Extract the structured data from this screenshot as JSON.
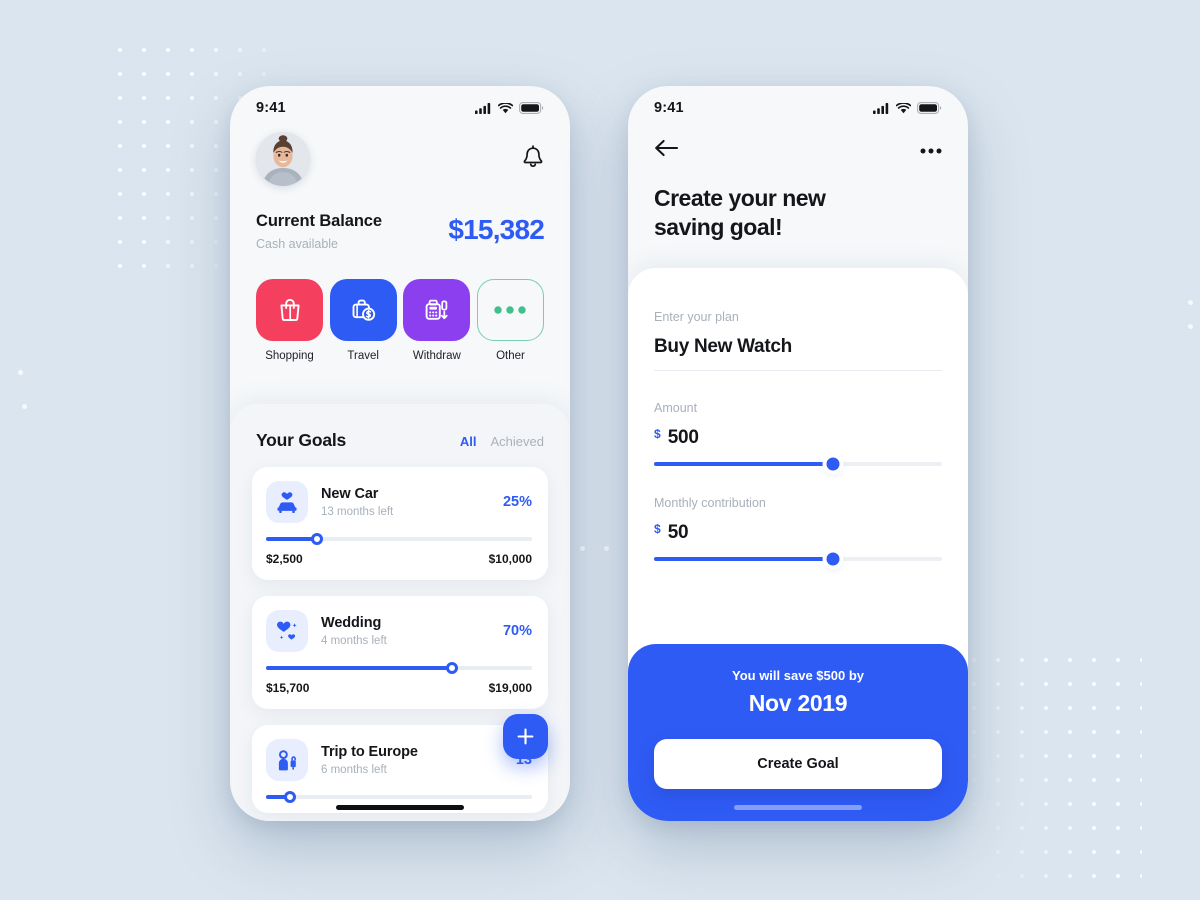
{
  "background": {
    "color": "#dbe5ef",
    "dot_color": "#ffffff"
  },
  "theme": {
    "accent_blue": "#2f5bf5",
    "shopping_pink": "#f43f5e",
    "travel_blue": "#2f5bf5",
    "withdraw_purple": "#8b3fef",
    "other_outline_green": "#77cfae",
    "text_dark": "#14161a",
    "text_muted": "#a8b0ba"
  },
  "home_screen": {
    "status_bar": {
      "time": "9:41",
      "icons": [
        "cellular-signal-icon",
        "wifi-icon",
        "battery-icon"
      ]
    },
    "avatar_name": "user-avatar",
    "notification_icon": "bell-icon",
    "balance": {
      "label": "Current Balance",
      "sublabel": "Cash available",
      "amount": "$15,382"
    },
    "actions": [
      {
        "label": "Shopping",
        "icon": "shopping-bag-icon",
        "color": "#f43f5e",
        "style": "filled"
      },
      {
        "label": "Travel",
        "icon": "suitcase-dollar-icon",
        "color": "#2f5bf5",
        "style": "filled"
      },
      {
        "label": "Withdraw",
        "icon": "atm-terminal-icon",
        "color": "#8b3fef",
        "style": "filled"
      },
      {
        "label": "Other",
        "icon": "ellipsis-icon",
        "color": "#77cfae",
        "style": "outline"
      }
    ],
    "goals": {
      "title": "Your Goals",
      "tabs": [
        {
          "label": "All",
          "active": true
        },
        {
          "label": "Achieved",
          "active": false
        }
      ],
      "items": [
        {
          "name": "New Car",
          "time_left": "13 months left",
          "percent_label": "25%",
          "percent": 25,
          "current": "$2,500",
          "target": "$10,000",
          "icon": "car-heart-icon"
        },
        {
          "name": "Wedding",
          "time_left": "4 months left",
          "percent_label": "70%",
          "percent": 70,
          "current": "$15,700",
          "target": "$19,000",
          "icon": "hearts-icon"
        },
        {
          "name": "Trip to Europe",
          "time_left": "6 months left",
          "percent_label": "13",
          "percent": 13,
          "current": "",
          "target": "",
          "icon": "traveler-luggage-icon"
        }
      ]
    },
    "add_goal_button": "+"
  },
  "create_screen": {
    "status_bar": {
      "time": "9:41",
      "icons": [
        "cellular-signal-icon",
        "wifi-icon",
        "battery-icon"
      ]
    },
    "back_icon": "arrow-left-icon",
    "more_icon": "ellipsis-horizontal-icon",
    "title": "Create your new\nsaving goal!",
    "title_line1": "Create your new",
    "title_line2": "saving goal!",
    "fields": {
      "plan": {
        "label": "Enter your plan",
        "value": "Buy New Watch"
      },
      "amount": {
        "label": "Amount",
        "currency": "$",
        "value": "500",
        "slider_percent": 62
      },
      "monthly": {
        "label": "Monthly contribution",
        "currency": "$",
        "value": "50",
        "slider_percent": 62
      }
    },
    "cta": {
      "line": "You will save $500 by",
      "date": "Nov 2019",
      "button": "Create Goal"
    }
  }
}
